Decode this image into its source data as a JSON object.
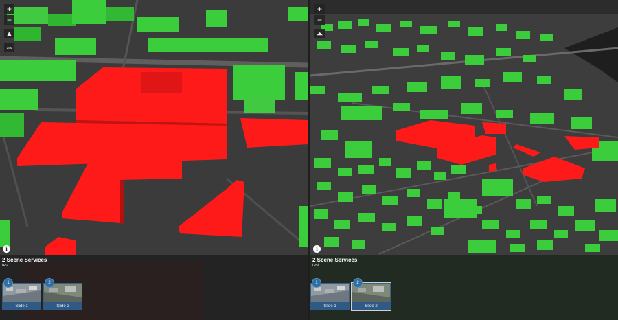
{
  "views": [
    {
      "id": "left",
      "controls": {
        "zoom_in": "+",
        "zoom_out": "−",
        "compass": "▲",
        "link": "⇔"
      },
      "info_icon": "i",
      "panel": {
        "title": "2 Scene Services",
        "subtitle": "test"
      },
      "slides": [
        {
          "number": "1",
          "label": "Slide 1"
        },
        {
          "number": "2",
          "label": "Slide 2"
        }
      ]
    },
    {
      "id": "right",
      "controls": {
        "zoom_in": "+",
        "zoom_out": "−",
        "compass": "⏶"
      },
      "info_icon": "i",
      "panel": {
        "title": "2 Scene Services",
        "subtitle": "test"
      },
      "slides": [
        {
          "number": "1",
          "label": "Slide 1"
        },
        {
          "number": "2",
          "label": "Slide 2"
        }
      ]
    }
  ],
  "map_label": "",
  "colors": {
    "highlight": "#ff1a1a",
    "buildings": "#3ccd3c",
    "ground": "#3a3a3a",
    "roads": "#5a5a5a"
  }
}
